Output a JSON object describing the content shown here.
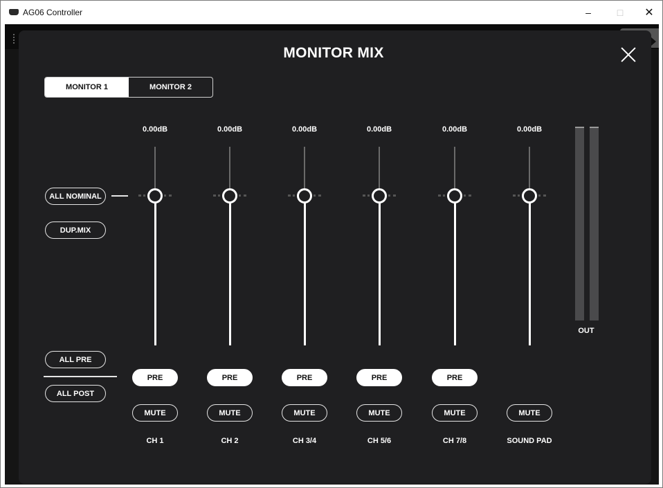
{
  "window": {
    "title": "AG06 Controller",
    "minimize": "–",
    "maximize": "□",
    "close": "✕"
  },
  "dialog": {
    "title": "MONITOR MIX"
  },
  "tabs": [
    {
      "label": "MONITOR 1",
      "active": true
    },
    {
      "label": "MONITOR 2",
      "active": false
    }
  ],
  "global_buttons": {
    "all_nominal": "ALL NOMINAL",
    "dup_mix": "DUP.MIX",
    "all_pre": "ALL PRE",
    "all_post": "ALL POST"
  },
  "channels": [
    {
      "name": "CH 1",
      "gain": "0.00dB",
      "pre": "PRE",
      "mute": "MUTE"
    },
    {
      "name": "CH 2",
      "gain": "0.00dB",
      "pre": "PRE",
      "mute": "MUTE"
    },
    {
      "name": "CH 3/4",
      "gain": "0.00dB",
      "pre": "PRE",
      "mute": "MUTE"
    },
    {
      "name": "CH 5/6",
      "gain": "0.00dB",
      "pre": "PRE",
      "mute": "MUTE"
    },
    {
      "name": "CH 7/8",
      "gain": "0.00dB",
      "pre": "PRE",
      "mute": "MUTE"
    },
    {
      "name": "SOUND PAD",
      "gain": "0.00dB",
      "mute": "MUTE"
    }
  ],
  "meter": {
    "label": "OUT",
    "level": 0
  },
  "icons": {
    "app": "mixer-icon",
    "close": "close-icon"
  },
  "colors": {
    "panel": "#1f1f21",
    "accent": "#ffffff",
    "track": "#6a6a6a"
  }
}
